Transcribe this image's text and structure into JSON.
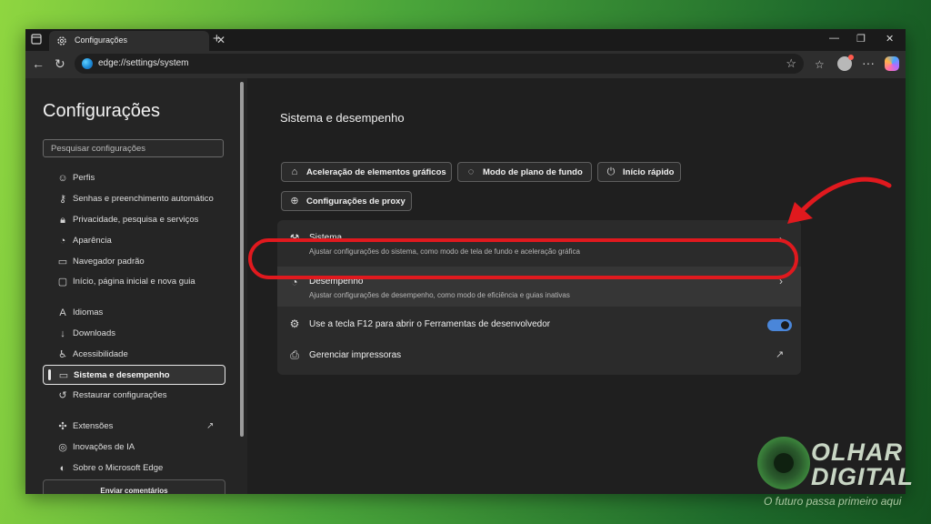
{
  "tab": {
    "title": "Configurações"
  },
  "address": {
    "url": "edge://settings/system"
  },
  "sidebar": {
    "title": "Configurações",
    "search_placeholder": "Pesquisar configurações",
    "items": [
      {
        "label": "Perfis",
        "icon": "person-icon"
      },
      {
        "label": "Senhas e preenchimento automático",
        "icon": "key-icon"
      },
      {
        "label": "Privacidade, pesquisa e serviços",
        "icon": "lock-icon"
      },
      {
        "label": "Aparência",
        "icon": "palette-icon"
      },
      {
        "label": "Navegador padrão",
        "icon": "browser-icon"
      },
      {
        "label": "Início, página inicial e nova guia",
        "icon": "home-icon"
      },
      {
        "label": "Idiomas",
        "icon": "language-icon"
      },
      {
        "label": "Downloads",
        "icon": "download-icon"
      },
      {
        "label": "Acessibilidade",
        "icon": "accessibility-icon"
      },
      {
        "label": "Sistema e desempenho",
        "icon": "laptop-icon",
        "active": true
      },
      {
        "label": "Restaurar configurações",
        "icon": "reset-icon"
      },
      {
        "label": "Extensões",
        "icon": "puzzle-icon"
      },
      {
        "label": "Inovações de IA",
        "icon": "ai-icon"
      },
      {
        "label": "Sobre o Microsoft Edge",
        "icon": "edge-icon"
      }
    ],
    "feedback_label": "Enviar comentários"
  },
  "main": {
    "title": "Sistema e desempenho",
    "chips": [
      {
        "label": "Aceleração de elementos gráficos",
        "icon": "gpu-icon"
      },
      {
        "label": "Modo de plano de fundo",
        "icon": "background-icon"
      },
      {
        "label": "Início rápido",
        "icon": "power-icon"
      },
      {
        "label": "Configurações de proxy",
        "icon": "globe-icon"
      }
    ],
    "rows": [
      {
        "title": "Sistema",
        "subtitle": "Ajustar configurações do sistema, como modo de tela de fundo e aceleração gráfica",
        "icon": "wrench-icon"
      },
      {
        "title": "Desempenho",
        "subtitle": "Ajustar configurações de desempenho, como modo de eficiência e guias inativas",
        "icon": "performance-icon"
      },
      {
        "title": "Use a tecla F12 para abrir o Ferramentas de desenvolvedor",
        "icon": "devtools-icon",
        "toggle_on": true
      },
      {
        "title": "Gerenciar impressoras",
        "icon": "printer-icon"
      }
    ]
  },
  "watermark": {
    "brand_line1": "OLHAR",
    "brand_line2": "DIGITAL",
    "tagline": "O futuro passa primeiro aqui"
  },
  "colors": {
    "highlight": "#e0191e",
    "toggle": "#4a86d9",
    "background_gradient_start": "#8fd640",
    "background_gradient_end": "#14521f"
  }
}
